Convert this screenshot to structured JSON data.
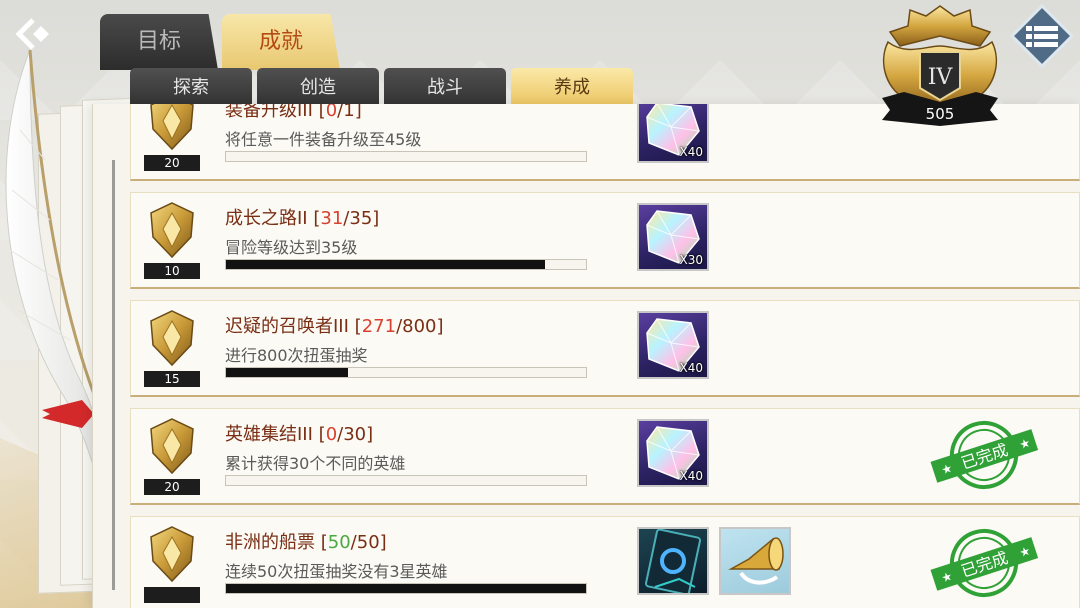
{
  "nav": {
    "back_icon": "back-arrow-icon",
    "menu_icon": "menu-icon"
  },
  "tabs": {
    "top": [
      {
        "label": "目标",
        "active": false
      },
      {
        "label": "成就",
        "active": true
      }
    ],
    "sub": [
      {
        "label": "探索",
        "active": false
      },
      {
        "label": "创造",
        "active": false
      },
      {
        "label": "战斗",
        "active": false
      },
      {
        "label": "养成",
        "active": true
      }
    ]
  },
  "emblem": {
    "rank": "IV",
    "points": "505"
  },
  "achievements": [
    {
      "title_name": "装备升级III",
      "current": "0",
      "total": "1",
      "current_color": "red",
      "desc": "将任意一件装备升级至45级",
      "level": "20",
      "progress": 0.0,
      "rewards": [
        {
          "type": "crystal",
          "qty": "X40"
        }
      ],
      "completed": false
    },
    {
      "title_name": "成长之路II",
      "current": "31",
      "total": "35",
      "current_color": "red",
      "desc": "冒险等级达到35级",
      "level": "10",
      "progress": 0.886,
      "rewards": [
        {
          "type": "crystal",
          "qty": "X30"
        }
      ],
      "completed": false
    },
    {
      "title_name": "迟疑的召唤者III",
      "current": "271",
      "total": "800",
      "current_color": "red",
      "desc": "进行800次扭蛋抽奖",
      "level": "15",
      "progress": 0.339,
      "rewards": [
        {
          "type": "crystal",
          "qty": "X40"
        }
      ],
      "completed": false
    },
    {
      "title_name": "英雄集结III",
      "current": "0",
      "total": "30",
      "current_color": "red",
      "desc": "累计获得30个不同的英雄",
      "level": "20",
      "progress": 0.0,
      "rewards": [
        {
          "type": "crystal",
          "qty": "X40"
        }
      ],
      "completed": true,
      "stamp_text": "已完成"
    },
    {
      "title_name": "非洲的船票",
      "current": "50",
      "total": "50",
      "current_color": "green",
      "desc": "连续50次扭蛋抽奖没有3星英雄",
      "level": "",
      "progress": 1.0,
      "rewards": [
        {
          "type": "card",
          "qty": ""
        },
        {
          "type": "horn",
          "qty": ""
        }
      ],
      "completed": true,
      "stamp_text": "已完成"
    }
  ]
}
